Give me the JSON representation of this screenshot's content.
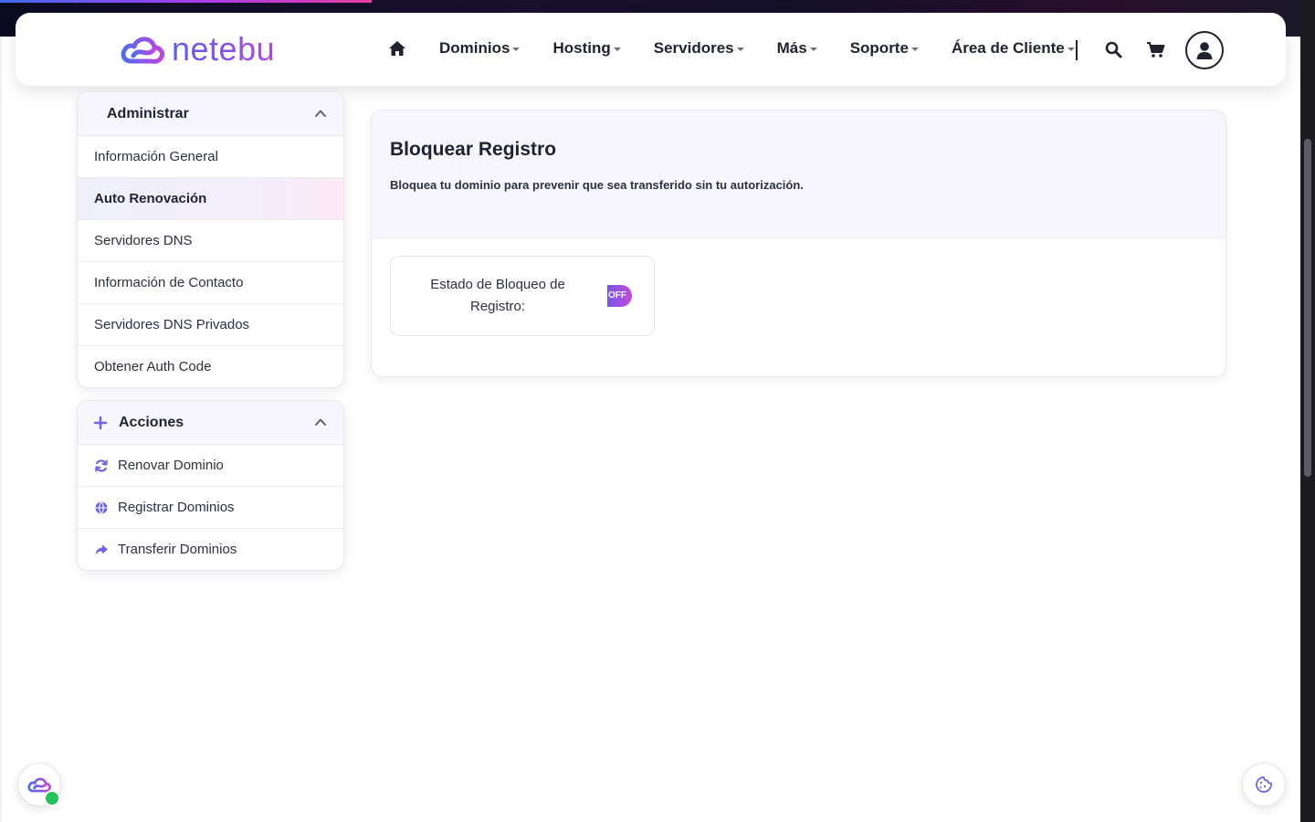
{
  "brand": {
    "name": "netebu",
    "accent": "#5b5cf0",
    "accent2": "#b146e6"
  },
  "nav": {
    "items": [
      "Dominios",
      "Hosting",
      "Servidores",
      "Más",
      "Soporte",
      "Área de Cliente"
    ],
    "icons": [
      "home-icon",
      "search-icon",
      "cart-icon",
      "user-icon"
    ]
  },
  "sidebar": {
    "admin": {
      "title": "Administrar",
      "items": [
        "Información General",
        "Auto Renovación",
        "Servidores DNS",
        "Información de Contacto",
        "Servidores DNS Privados",
        "Obtener Auth Code"
      ],
      "active_index": 1
    },
    "actions": {
      "title": "Acciones",
      "items": [
        "Renovar Dominio",
        "Registrar Dominios",
        "Transferir Dominios"
      ]
    }
  },
  "main": {
    "title": "Bloquear Registro",
    "subtitle": "Bloquea tu dominio para prevenir que sea transferido sin tu autorización.",
    "status_label": "Estado de Bloqueo de Registro:",
    "toggle_text": "OFF"
  }
}
